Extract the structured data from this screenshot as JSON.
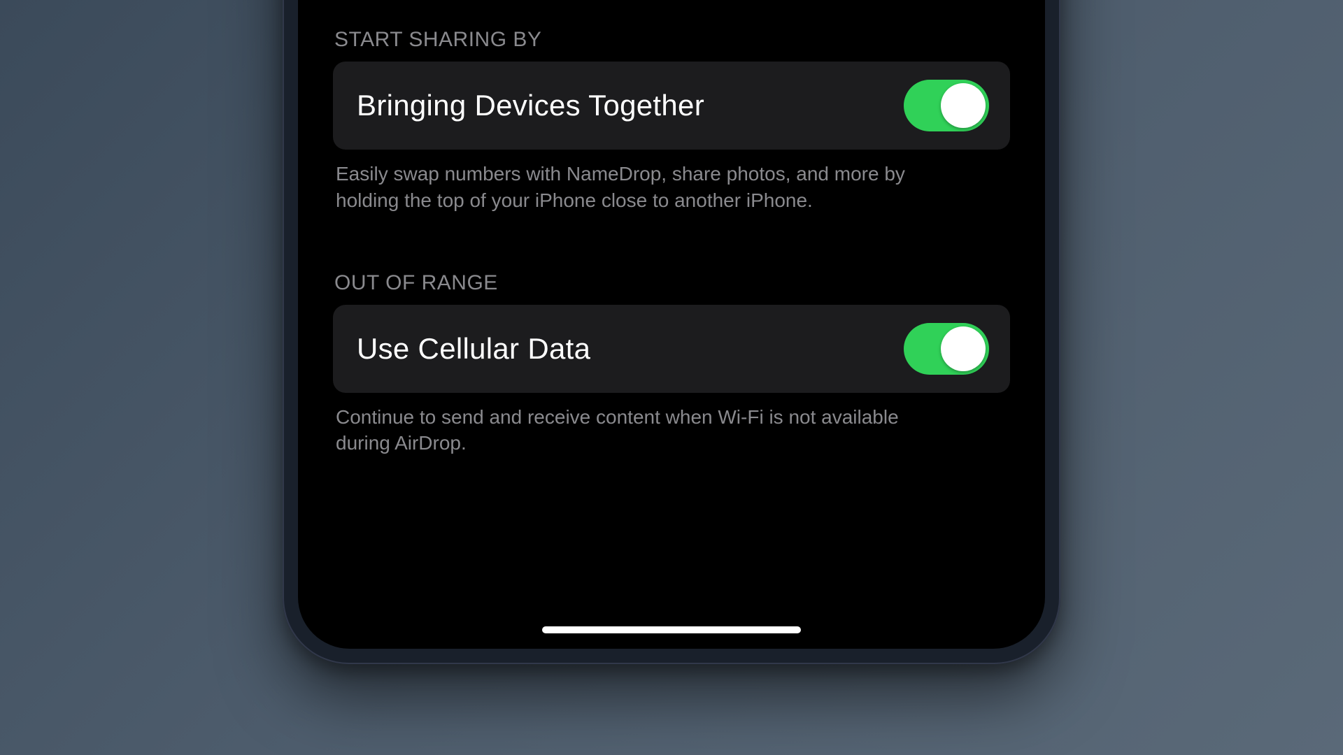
{
  "sections": [
    {
      "header": "START SHARING BY",
      "row_label": "Bringing Devices Together",
      "footer": "Easily swap numbers with NameDrop, share photos, and more by holding the top of your iPhone close to another iPhone.",
      "switch_on": true
    },
    {
      "header": "OUT OF RANGE",
      "row_label": "Use Cellular Data",
      "footer": "Continue to send and receive content when Wi-Fi is not available during AirDrop.",
      "switch_on": true
    }
  ],
  "colors": {
    "switch_on": "#30d158",
    "card_bg": "#1c1c1e",
    "secondary_text": "#8a8a8e"
  }
}
